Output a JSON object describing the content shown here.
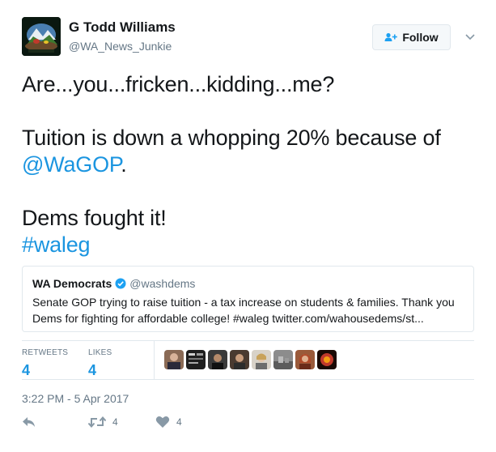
{
  "author": {
    "display_name": "G Todd Williams",
    "handle": "@WA_News_Junkie"
  },
  "follow_button": {
    "label": "Follow"
  },
  "tweet": {
    "line1": "Are...you...fricken...kidding...me?",
    "line2_text": "Tuition is down a whopping 20% because of",
    "line2_mention": "@WaGOP",
    "line2_period": ".",
    "line3": "Dems fought it!",
    "line4_hashtag": "#waleg"
  },
  "quoted_tweet": {
    "display_name": "WA Democrats",
    "handle": "@washdems",
    "text": "Senate GOP trying to raise tuition - a tax increase on students & families. Thank you Dems for fighting for affordable college! #waleg twitter.com/wahousedems/st..."
  },
  "stats": {
    "retweets_label": "RETWEETS",
    "retweets_value": "4",
    "likes_label": "LIKES",
    "likes_value": "4"
  },
  "timestamp": "3:22 PM - 5 Apr 2017",
  "actions": {
    "retweet_count": "4",
    "like_count": "4"
  },
  "colors": {
    "link": "#1b95e0",
    "muted": "#657786",
    "border": "#e1e8ed",
    "verified": "#1da1f2"
  }
}
